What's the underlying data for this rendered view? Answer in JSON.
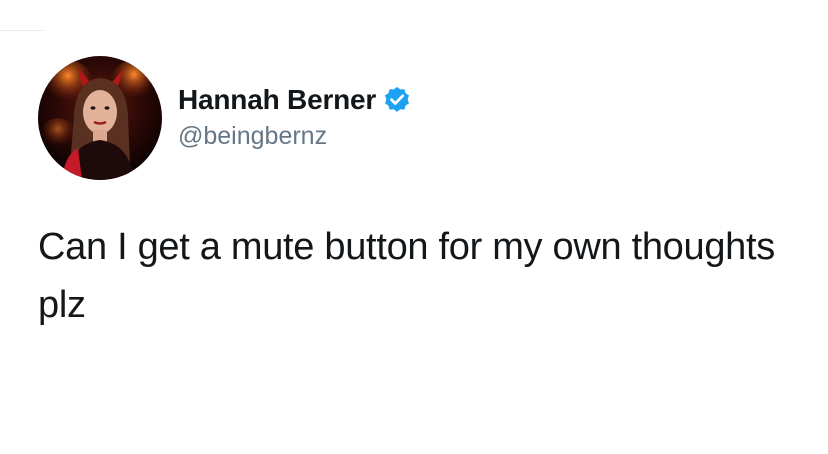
{
  "tweet": {
    "author": {
      "display_name": "Hannah Berner",
      "handle": "@beingbernz",
      "verified": true,
      "avatar_icon": "profile-photo"
    },
    "text": "Can I get a mute button for my own thoughts plz"
  },
  "colors": {
    "background": "#ffffff",
    "name": "#14171a",
    "handle": "#657786",
    "verified_badge": "#1da1f2"
  }
}
